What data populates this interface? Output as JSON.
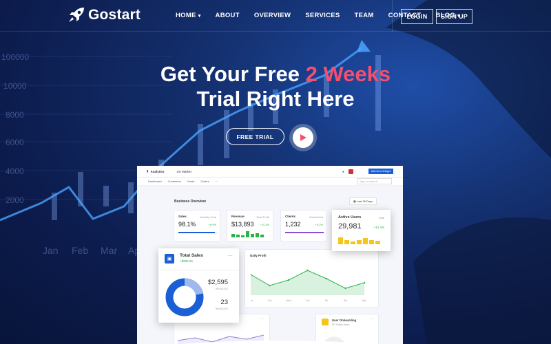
{
  "brand": {
    "name": "Gostart"
  },
  "nav": {
    "items": [
      {
        "label": "HOME",
        "dropdown": true
      },
      {
        "label": "ABOUT",
        "dropdown": false
      },
      {
        "label": "OVERVIEW",
        "dropdown": false
      },
      {
        "label": "SERVICES",
        "dropdown": false
      },
      {
        "label": "TEAM",
        "dropdown": false
      },
      {
        "label": "CONTACT",
        "dropdown": false
      },
      {
        "label": "BLOG",
        "dropdown": true
      }
    ],
    "login": "LOGIN",
    "signup": "SIGN UP"
  },
  "hero": {
    "line1_pre": "Get Your Free ",
    "line1_accent": "2 Weeks",
    "line2": "Trial Right Here",
    "cta": "FREE TRIAL"
  },
  "background_chart": {
    "y_labels": [
      "10000",
      "8000",
      "6000",
      "4000",
      "2000"
    ],
    "y_labels_top": "100000",
    "x_labels": [
      "Jan",
      "Feb",
      "Mar",
      "Ap"
    ]
  },
  "dashboard": {
    "app_name": "Analytics",
    "market": "US Market",
    "add_button": "Add New Widget",
    "tabs": [
      "Dashboard",
      "Customers",
      "Goals",
      "Orders"
    ],
    "search_placeholder": "Type to search",
    "section_title": "Business Overview",
    "date_filter": "Last 30 Days",
    "kpis": [
      {
        "label": "Sales",
        "sub": "Monthly Goal",
        "value": "98.1%",
        "change": "+6.9%"
      },
      {
        "label": "Revenue",
        "sub": "Total Profit",
        "value": "$13,893",
        "change": "+11.3%"
      },
      {
        "label": "Clients",
        "sub": "Subscribed",
        "value": "1,232",
        "change": "+5.2%"
      }
    ],
    "active_users": {
      "label": "Active Users",
      "sub": "Total",
      "value": "29,981",
      "change": "+12.4%"
    },
    "total_sales": {
      "title": "Total Sales",
      "sub": "+$985.56",
      "amount": "$2,595",
      "amount_label": "INVOICES",
      "count": "23",
      "count_label": "INVOICES"
    },
    "daily_profit": {
      "title": "Daily Profit",
      "x": [
        "Mon",
        "Tue",
        "Wed",
        "Thu",
        "Fri",
        "Sat",
        "Sun"
      ],
      "values": [
        3,
        2.2,
        2.6,
        3.3,
        2.7,
        2.0,
        2.4
      ]
    },
    "user_onboarding": {
      "title": "User Onboarding",
      "sub": "50 Total Users"
    }
  },
  "colors": {
    "accent": "#f2506e",
    "primary": "#1a5fd6",
    "yellow": "#f5c518",
    "green": "#2bb34b"
  }
}
